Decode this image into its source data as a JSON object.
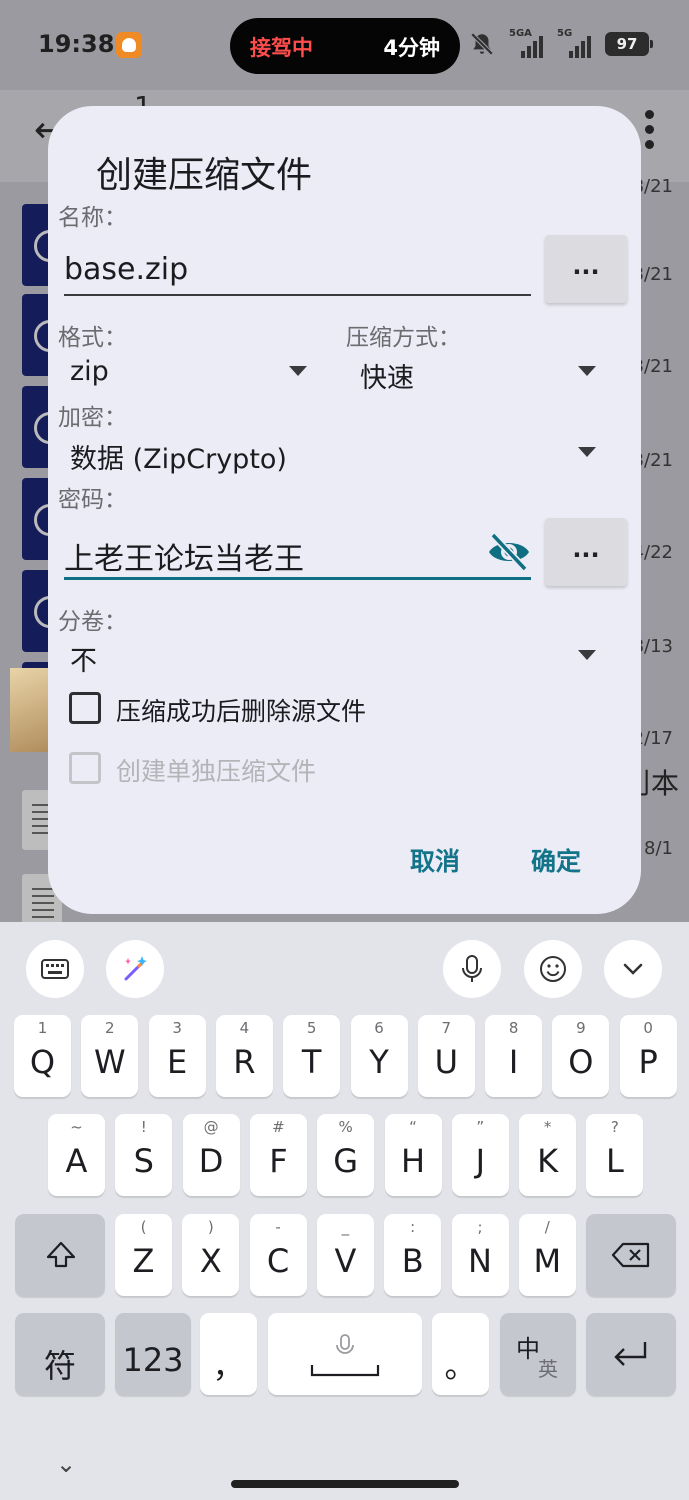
{
  "status_bar": {
    "time": "19:38",
    "pill_left": "接驾中",
    "pill_right": "4分钟",
    "signal1_label": "5GA",
    "signal2_label": "5G",
    "battery": "97"
  },
  "background": {
    "title": "1",
    "dates": [
      "8/21",
      "3/21",
      "3/21",
      "3/21",
      "4/22",
      "8/13",
      "2/17",
      "8/1"
    ],
    "side_text": "刂本"
  },
  "dialog": {
    "title": "创建压缩文件",
    "name_label": "名称：",
    "name_value": "base.zip",
    "name_more": "...",
    "format_label": "格式：",
    "format_value": "zip",
    "method_label": "压缩方式：",
    "method_value": "快速",
    "encrypt_label": "加密：",
    "encrypt_value": "数据 (ZipCrypto)",
    "password_label": "密码：",
    "password_value": "上老王论坛当老王",
    "password_more": "...",
    "split_label": "分卷：",
    "split_value": "不",
    "delete_source_label": "压缩成功后删除源文件",
    "separate_archives_label": "创建单独压缩文件",
    "cancel": "取消",
    "ok": "确定"
  },
  "keyboard": {
    "row1": [
      {
        "hint": "1",
        "key": "Q"
      },
      {
        "hint": "2",
        "key": "W"
      },
      {
        "hint": "3",
        "key": "E"
      },
      {
        "hint": "4",
        "key": "R"
      },
      {
        "hint": "5",
        "key": "T"
      },
      {
        "hint": "6",
        "key": "Y"
      },
      {
        "hint": "7",
        "key": "U"
      },
      {
        "hint": "8",
        "key": "I"
      },
      {
        "hint": "9",
        "key": "O"
      },
      {
        "hint": "0",
        "key": "P"
      }
    ],
    "row2": [
      {
        "hint": "~",
        "key": "A"
      },
      {
        "hint": "!",
        "key": "S"
      },
      {
        "hint": "@",
        "key": "D"
      },
      {
        "hint": "#",
        "key": "F"
      },
      {
        "hint": "%",
        "key": "G"
      },
      {
        "hint": "“",
        "key": "H"
      },
      {
        "hint": "”",
        "key": "J"
      },
      {
        "hint": "*",
        "key": "K"
      },
      {
        "hint": "?",
        "key": "L"
      }
    ],
    "row3": [
      {
        "hint": "(",
        "key": "Z"
      },
      {
        "hint": ")",
        "key": "X"
      },
      {
        "hint": "-",
        "key": "C"
      },
      {
        "hint": "_",
        "key": "V"
      },
      {
        "hint": ":",
        "key": "B"
      },
      {
        "hint": ";",
        "key": "N"
      },
      {
        "hint": "/",
        "key": "M"
      }
    ],
    "symbols_key": "符",
    "numbers_key": "123",
    "comma_key": "，",
    "period_key": "。",
    "lang_key_top": "中",
    "lang_key_bottom": "英"
  }
}
